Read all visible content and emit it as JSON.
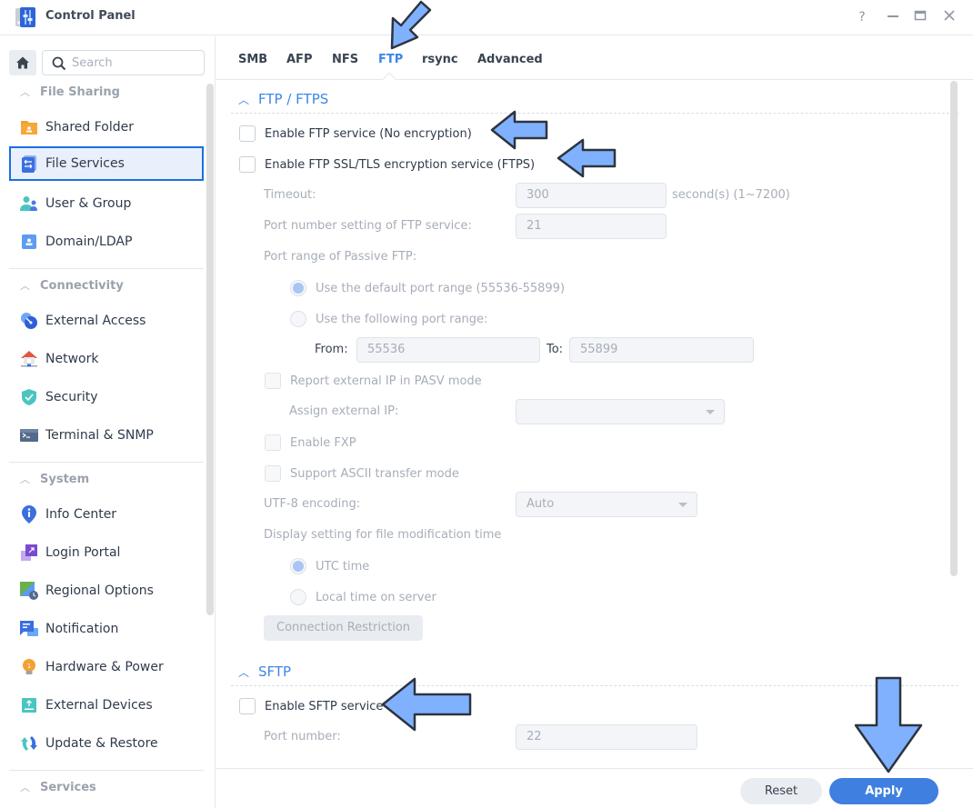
{
  "window": {
    "title": "Control Panel",
    "controls": {
      "help": "?",
      "minimize": "—",
      "maximize": "▭",
      "close": "✕"
    }
  },
  "sidebar": {
    "search_placeholder": "Search",
    "groups": [
      {
        "label": "File Sharing",
        "items": [
          {
            "label": "Shared Folder",
            "icon": "shared-folder-icon"
          },
          {
            "label": "File Services",
            "icon": "file-services-icon",
            "active": true
          },
          {
            "label": "User & Group",
            "icon": "user-group-icon"
          },
          {
            "label": "Domain/LDAP",
            "icon": "domain-ldap-icon"
          }
        ]
      },
      {
        "label": "Connectivity",
        "items": [
          {
            "label": "External Access",
            "icon": "external-access-icon"
          },
          {
            "label": "Network",
            "icon": "network-icon"
          },
          {
            "label": "Security",
            "icon": "security-shield-icon"
          },
          {
            "label": "Terminal & SNMP",
            "icon": "terminal-icon"
          }
        ]
      },
      {
        "label": "System",
        "items": [
          {
            "label": "Info Center",
            "icon": "info-center-icon"
          },
          {
            "label": "Login Portal",
            "icon": "login-portal-icon"
          },
          {
            "label": "Regional Options",
            "icon": "regional-options-icon"
          },
          {
            "label": "Notification",
            "icon": "notification-icon"
          },
          {
            "label": "Hardware & Power",
            "icon": "hardware-power-icon"
          },
          {
            "label": "External Devices",
            "icon": "external-devices-icon"
          },
          {
            "label": "Update & Restore",
            "icon": "update-restore-icon"
          }
        ]
      },
      {
        "label": "Services",
        "items": []
      }
    ]
  },
  "tabs": [
    {
      "label": "SMB"
    },
    {
      "label": "AFP"
    },
    {
      "label": "NFS"
    },
    {
      "label": "FTP",
      "active": true
    },
    {
      "label": "rsync"
    },
    {
      "label": "Advanced"
    }
  ],
  "ftp_section": {
    "title": "FTP / FTPS",
    "enable_ftp": {
      "label": "Enable FTP service (No encryption)",
      "checked": false
    },
    "enable_ftps": {
      "label": "Enable FTP SSL/TLS encryption service (FTPS)",
      "checked": false
    },
    "timeout": {
      "label": "Timeout:",
      "value": "300",
      "hint": "second(s) (1~7200)"
    },
    "port": {
      "label": "Port number setting of FTP service:",
      "value": "21"
    },
    "passive_range": {
      "label": "Port range of Passive FTP:",
      "default_option": {
        "label": "Use the default port range (55536-55899)",
        "selected": true
      },
      "custom_option": {
        "label": "Use the following port range:",
        "selected": false
      },
      "from_label": "From:",
      "from_value": "55536",
      "to_label": "To:",
      "to_value": "55899"
    },
    "report_external_ip": {
      "label": "Report external IP in PASV mode",
      "checked": false
    },
    "assign_external_ip": {
      "label": "Assign external IP:",
      "value": ""
    },
    "enable_fxp": {
      "label": "Enable FXP",
      "checked": false
    },
    "ascii_mode": {
      "label": "Support ASCII transfer mode",
      "checked": false
    },
    "utf8": {
      "label": "UTF-8 encoding:",
      "value": "Auto"
    },
    "mod_time": {
      "label": "Display setting for file modification time",
      "utc": {
        "label": "UTC time",
        "selected": true
      },
      "local": {
        "label": "Local time on server",
        "selected": false
      }
    },
    "connection_restriction_label": "Connection Restriction"
  },
  "sftp_section": {
    "title": "SFTP",
    "enable_sftp": {
      "label": "Enable SFTP service",
      "checked": false
    },
    "port": {
      "label": "Port number:",
      "value": "22"
    }
  },
  "footer": {
    "reset_label": "Reset",
    "apply_label": "Apply"
  },
  "colors": {
    "accent": "#3d86e8",
    "apply_button": "#3e7fe0",
    "annotation_arrow": "#80b1ff"
  }
}
